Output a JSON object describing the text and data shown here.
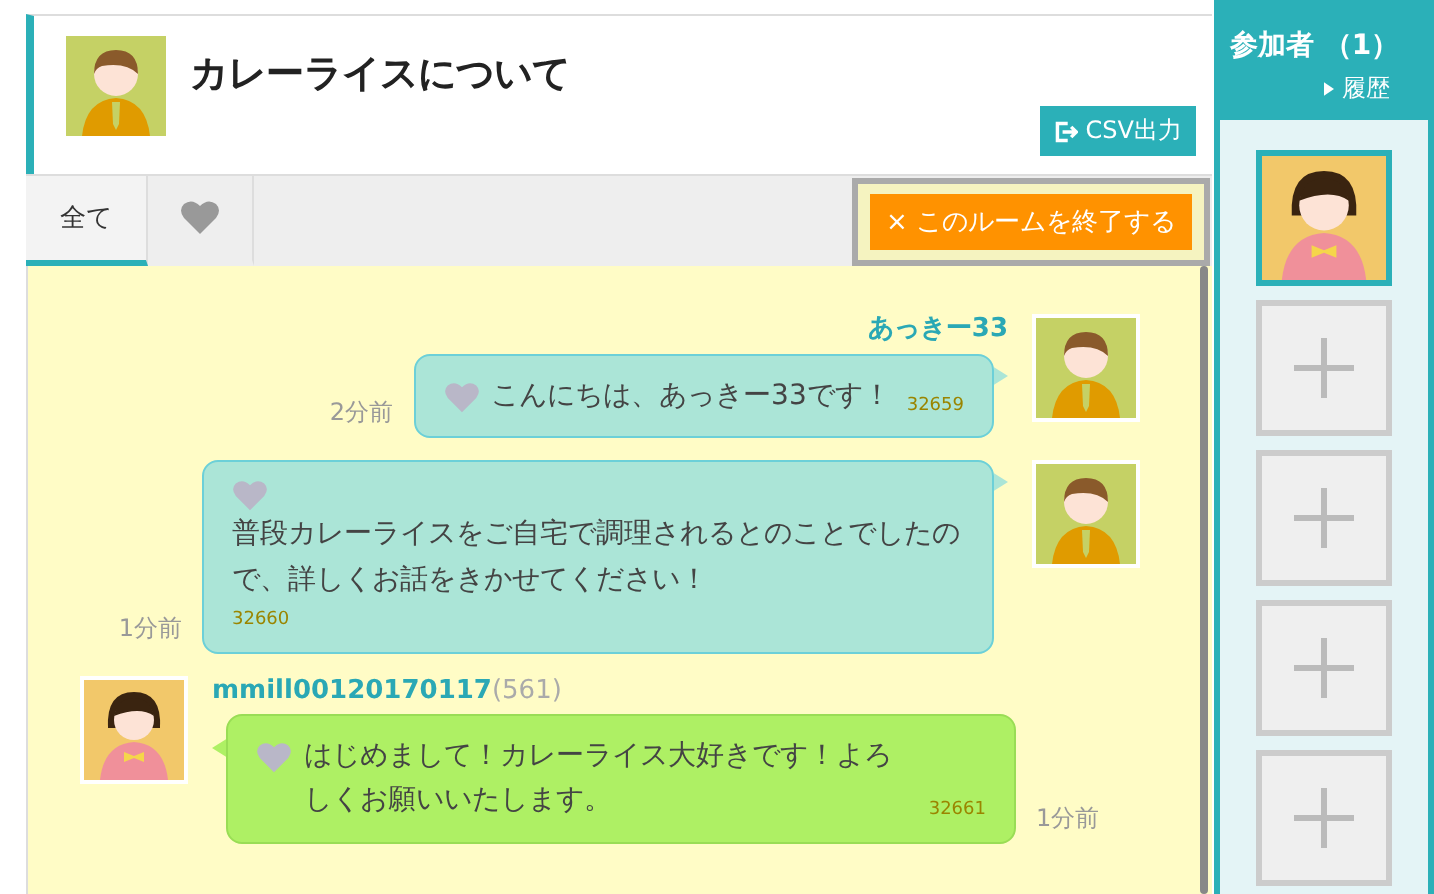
{
  "room": {
    "title": "カレーライスについて",
    "csv_button": "CSV出力"
  },
  "tabs": [
    {
      "kind": "text",
      "label": "全て",
      "selected": true
    },
    {
      "kind": "heart",
      "selected": false
    }
  ],
  "end_button": "× このルームを終了する",
  "messages": [
    {
      "kind": "sent",
      "sender": "あっきー33",
      "text": "こんにちは、あっきー33です！",
      "number": "32659",
      "time": "2分前"
    },
    {
      "kind": "sentlong",
      "text": "普段カレーライスをご自宅で調理されるとのことでしたので、詳しくお話をきかせてください！",
      "number": "32660",
      "time": "1分前"
    },
    {
      "kind": "received",
      "sender": "mmill00120170117",
      "count": "(561)",
      "text": "はじめまして！カレーライス大好きです！よろしくお願いいたします。",
      "number": "32661",
      "time": "1分前"
    }
  ],
  "sidebar": {
    "title": "参加者 （1）",
    "history_link": "履歴",
    "slots": [
      {
        "kind": "member",
        "selected": true
      },
      {
        "kind": "empty",
        "selected": false
      },
      {
        "kind": "empty",
        "selected": false
      },
      {
        "kind": "empty",
        "selected": false
      },
      {
        "kind": "empty",
        "selected": false
      }
    ]
  }
}
